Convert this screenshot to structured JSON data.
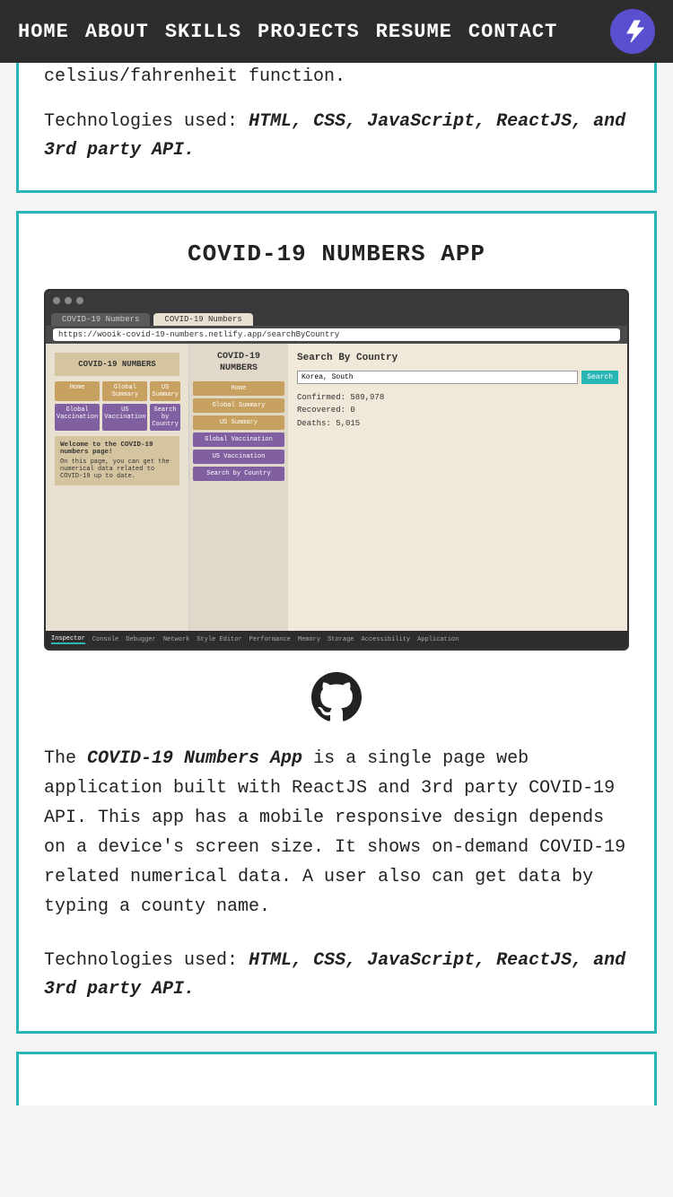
{
  "nav": {
    "links": [
      {
        "label": "HOME",
        "name": "home"
      },
      {
        "label": "ABOUT",
        "name": "about"
      },
      {
        "label": "SKILLS",
        "name": "skills"
      },
      {
        "label": "PROJECTS",
        "name": "projects"
      },
      {
        "label": "RESUME",
        "name": "resume"
      },
      {
        "label": "CONTACT",
        "name": "contact"
      }
    ],
    "avatar_icon": "⚡"
  },
  "partial_top_card": {
    "text_prefix": "celsius/fahrenheit function.",
    "tech_label": "Technologies used:",
    "tech_stack": "HTML, CSS, JavaScript, ReactJS, and 3rd party API."
  },
  "covid_card": {
    "title": "COVID-19 NUMBERS APP",
    "browser": {
      "tab1": "COVID-19 Numbers",
      "tab2": "COVID-19 Numbers",
      "address": "https://wooik-covid-19-numbers.netlify.app/searchByCountry",
      "app_logo": "COVID-19 NUMBERS",
      "nav_buttons": [
        "Home",
        "Global Summary",
        "US Summary",
        "Global Vaccination",
        "US Vaccination",
        "Search by Country"
      ],
      "welcome_title": "Welcome to the COVID-19 numbers page!",
      "welcome_body": "On this page, you can get the numerical data related to COVID-19 up to date.",
      "sidebar_logo": "COVID-19\nNUMBERS",
      "sidebar_links": [
        "Home",
        "Global Summary",
        "US Summary",
        "Global Vaccination",
        "US Vaccination",
        "Search by Country"
      ],
      "search_title": "Search By Country",
      "search_placeholder": "Korea, South",
      "search_btn": "Search",
      "confirmed": "Confirmed: 589,978",
      "recovered": "Recovered: 0",
      "deaths": "Deaths: 5,015",
      "devtools_tabs": [
        "Inspector",
        "Console",
        "Debugger",
        "Network",
        "Style Editor",
        "Performance",
        "Memory",
        "Storage",
        "Accessibility",
        "Application"
      ]
    },
    "description_prefix": "The ",
    "description_em": "COVID-19 Numbers App",
    "description_body": " is a single page web application built with ReactJS and 3rd party COVID-19 API. This app has a mobile responsive design depends on a device's screen size. It shows on-demand COVID-19 related numerical data. A user also can get data by typing a county name.",
    "tech_label": "Technologies used:",
    "tech_stack": "HTML, CSS, JavaScript, ReactJS, and 3rd party API."
  },
  "bottom_card": {}
}
